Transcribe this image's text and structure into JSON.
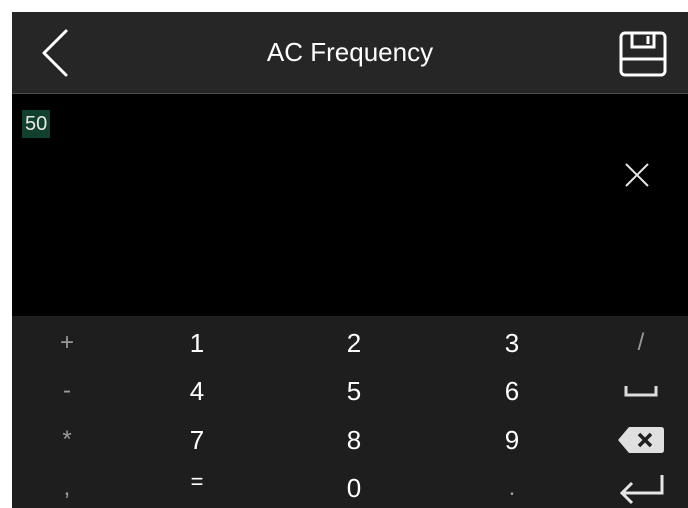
{
  "header": {
    "title": "AC Frequency",
    "back_icon": "chevron-left-icon",
    "save_icon": "floppy-disk-icon"
  },
  "input": {
    "value": "50",
    "clear_icon": "close-icon"
  },
  "keypad": {
    "rows": [
      [
        "+",
        "1",
        "2",
        "3",
        "/"
      ],
      [
        "-",
        "4",
        "5",
        "6",
        "space"
      ],
      [
        "*",
        "7",
        "8",
        "9",
        "backspace"
      ],
      [
        ",",
        "=",
        "0",
        ".",
        "enter"
      ]
    ],
    "space_icon": "space-bar-icon",
    "backspace_icon": "backspace-icon",
    "enter_icon": "enter-icon"
  },
  "colors": {
    "header_bg": "#262626",
    "screen_bg": "#000000",
    "keypad_bg": "#1e1e1e",
    "selection_bg": "#12402e",
    "side_key_text": "#9a9a9a",
    "text": "#ffffff"
  }
}
